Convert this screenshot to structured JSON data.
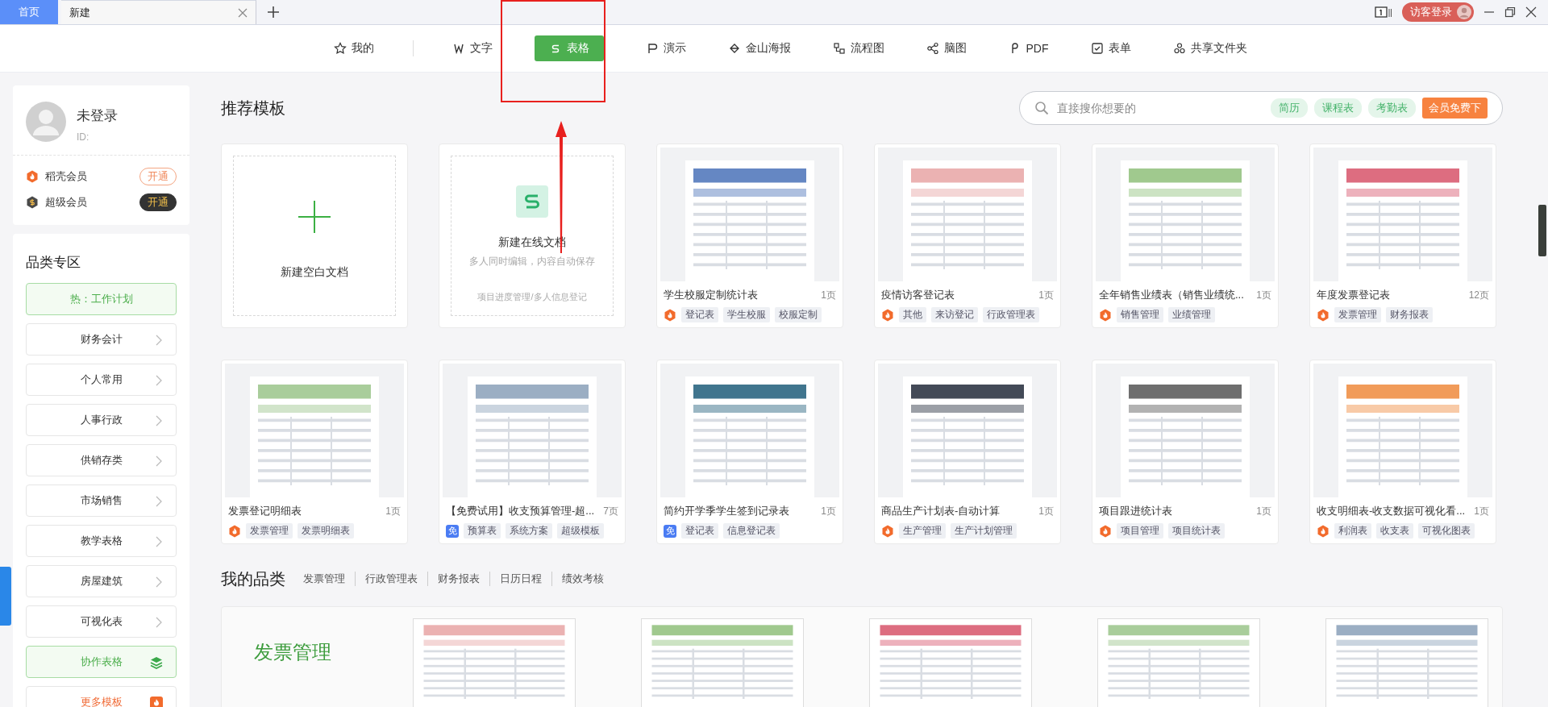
{
  "tabs": [
    {
      "label": "首页",
      "selected": false,
      "closable": false
    },
    {
      "label": "新建",
      "selected": true,
      "closable": true
    }
  ],
  "title_bar": {
    "login_button": "访客登录"
  },
  "nav": [
    {
      "label": "我的",
      "selected": false
    },
    {
      "label": "文字",
      "selected": false
    },
    {
      "label": "表格",
      "selected": true
    },
    {
      "label": "演示",
      "selected": false
    },
    {
      "label": "金山海报",
      "selected": false
    },
    {
      "label": "流程图",
      "selected": false
    },
    {
      "label": "脑图",
      "selected": false
    },
    {
      "label": "PDF",
      "selected": false
    },
    {
      "label": "表单",
      "selected": false
    },
    {
      "label": "共享文件夹",
      "selected": false
    }
  ],
  "user": {
    "name": "未登录",
    "id_label": "ID:",
    "memberships": [
      {
        "kind": "docer",
        "name": "稻壳会员",
        "button": "开通"
      },
      {
        "kind": "super",
        "name": "超级会员",
        "button": "开通"
      }
    ]
  },
  "categories": {
    "title": "品类专区",
    "items": [
      {
        "kind": "hot",
        "label": "热：工作计划"
      },
      {
        "kind": "normal",
        "label": "财务会计"
      },
      {
        "kind": "normal",
        "label": "个人常用"
      },
      {
        "kind": "normal",
        "label": "人事行政"
      },
      {
        "kind": "normal",
        "label": "供销存类"
      },
      {
        "kind": "normal",
        "label": "市场销售"
      },
      {
        "kind": "normal",
        "label": "教学表格"
      },
      {
        "kind": "normal",
        "label": "房屋建筑"
      },
      {
        "kind": "normal",
        "label": "可视化表"
      },
      {
        "kind": "collab",
        "label": "协作表格"
      },
      {
        "kind": "more",
        "label": "更多模板"
      }
    ]
  },
  "recommended": {
    "title": "推荐模板",
    "search": {
      "placeholder": "直接搜你想要的"
    },
    "tags": [
      "简历",
      "课程表",
      "考勤表"
    ],
    "promo": "会员免费下",
    "cards": [
      {
        "kind": "blank",
        "label": "新建空白文档"
      },
      {
        "kind": "online",
        "title": "新建在线文档",
        "subtitle": "多人同时编辑，内容自动保存",
        "footer": "项目进度管理/多人信息登记"
      },
      {
        "kind": "template",
        "title": "学生校服定制统计表",
        "pages": "1页",
        "badge": {
          "kind": "docer"
        },
        "tags": [
          "登记表",
          "学生校服",
          "校服定制"
        ]
      },
      {
        "kind": "template",
        "title": "疫情访客登记表",
        "pages": "1页",
        "badge": {
          "kind": "docer"
        },
        "tags": [
          "其他",
          "来访登记",
          "行政管理表"
        ]
      },
      {
        "kind": "template",
        "title": "全年销售业绩表（销售业绩统...",
        "pages": "1页",
        "badge": {
          "kind": "docer"
        },
        "tags": [
          "销售管理",
          "业绩管理"
        ]
      },
      {
        "kind": "template",
        "title": "年度发票登记表",
        "pages": "12页",
        "badge": {
          "kind": "docer"
        },
        "tags": [
          "发票管理",
          "财务报表"
        ]
      },
      {
        "kind": "template",
        "title": "发票登记明细表",
        "pages": "1页",
        "badge": {
          "kind": "docer"
        },
        "tags": [
          "发票管理",
          "发票明细表"
        ]
      },
      {
        "kind": "template",
        "title": "【免费试用】收支预算管理-超...",
        "pages": "7页",
        "badge": {
          "kind": "free",
          "label": "免"
        },
        "tags": [
          "预算表",
          "系统方案",
          "超级模板"
        ]
      },
      {
        "kind": "template",
        "title": "简约开学季学生签到记录表",
        "pages": "1页",
        "badge": {
          "kind": "free",
          "label": "免"
        },
        "tags": [
          "登记表",
          "信息登记表"
        ]
      },
      {
        "kind": "template",
        "title": "商品生产计划表-自动计算",
        "pages": "1页",
        "badge": {
          "kind": "docer"
        },
        "tags": [
          "生产管理",
          "生产计划管理"
        ]
      },
      {
        "kind": "template",
        "title": "项目跟进统计表",
        "pages": "1页",
        "badge": {
          "kind": "docer"
        },
        "tags": [
          "项目管理",
          "项目统计表"
        ]
      },
      {
        "kind": "template",
        "title": "收支明细表-收支数据可视化看...",
        "pages": "1页",
        "badge": {
          "kind": "docer"
        },
        "tags": [
          "利润表",
          "收支表",
          "可视化图表"
        ]
      }
    ]
  },
  "my_categories": {
    "title": "我的品类",
    "links": [
      "发票管理",
      "行政管理表",
      "财务报表",
      "日历日程",
      "绩效考核"
    ],
    "section_label": "发票管理"
  }
}
